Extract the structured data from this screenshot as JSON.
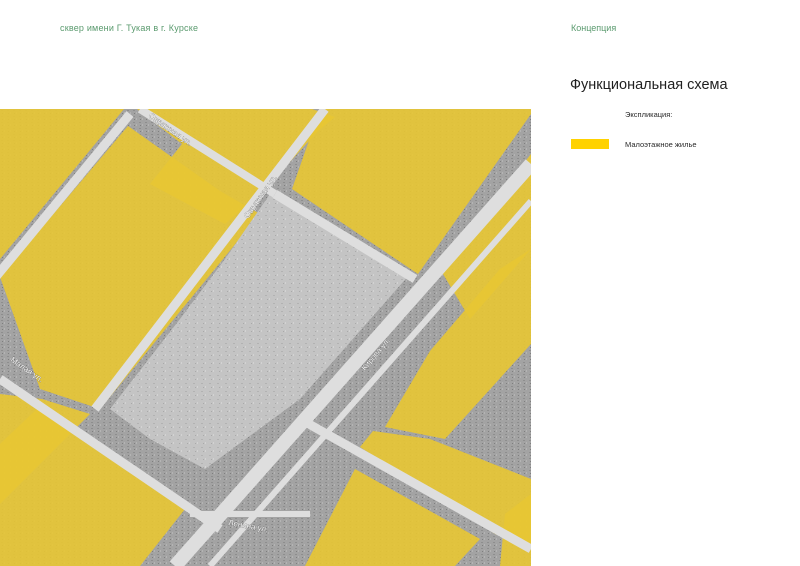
{
  "header": {
    "project_title": "сквер имени Г. Тукая в г. Курске",
    "section": "Концепция"
  },
  "page_title": "Функциональная схема",
  "legend": {
    "heading": "Экспликация:",
    "items": [
      {
        "label": "Малоэтажное жилье",
        "color": "#ffd200"
      }
    ]
  },
  "map": {
    "zone_color": "#e8c733",
    "street_labels": [
      "Овражная ул.",
      "Овражная ул.",
      "Кирова ул.",
      "Малая ул.",
      "Ленина ул."
    ]
  }
}
